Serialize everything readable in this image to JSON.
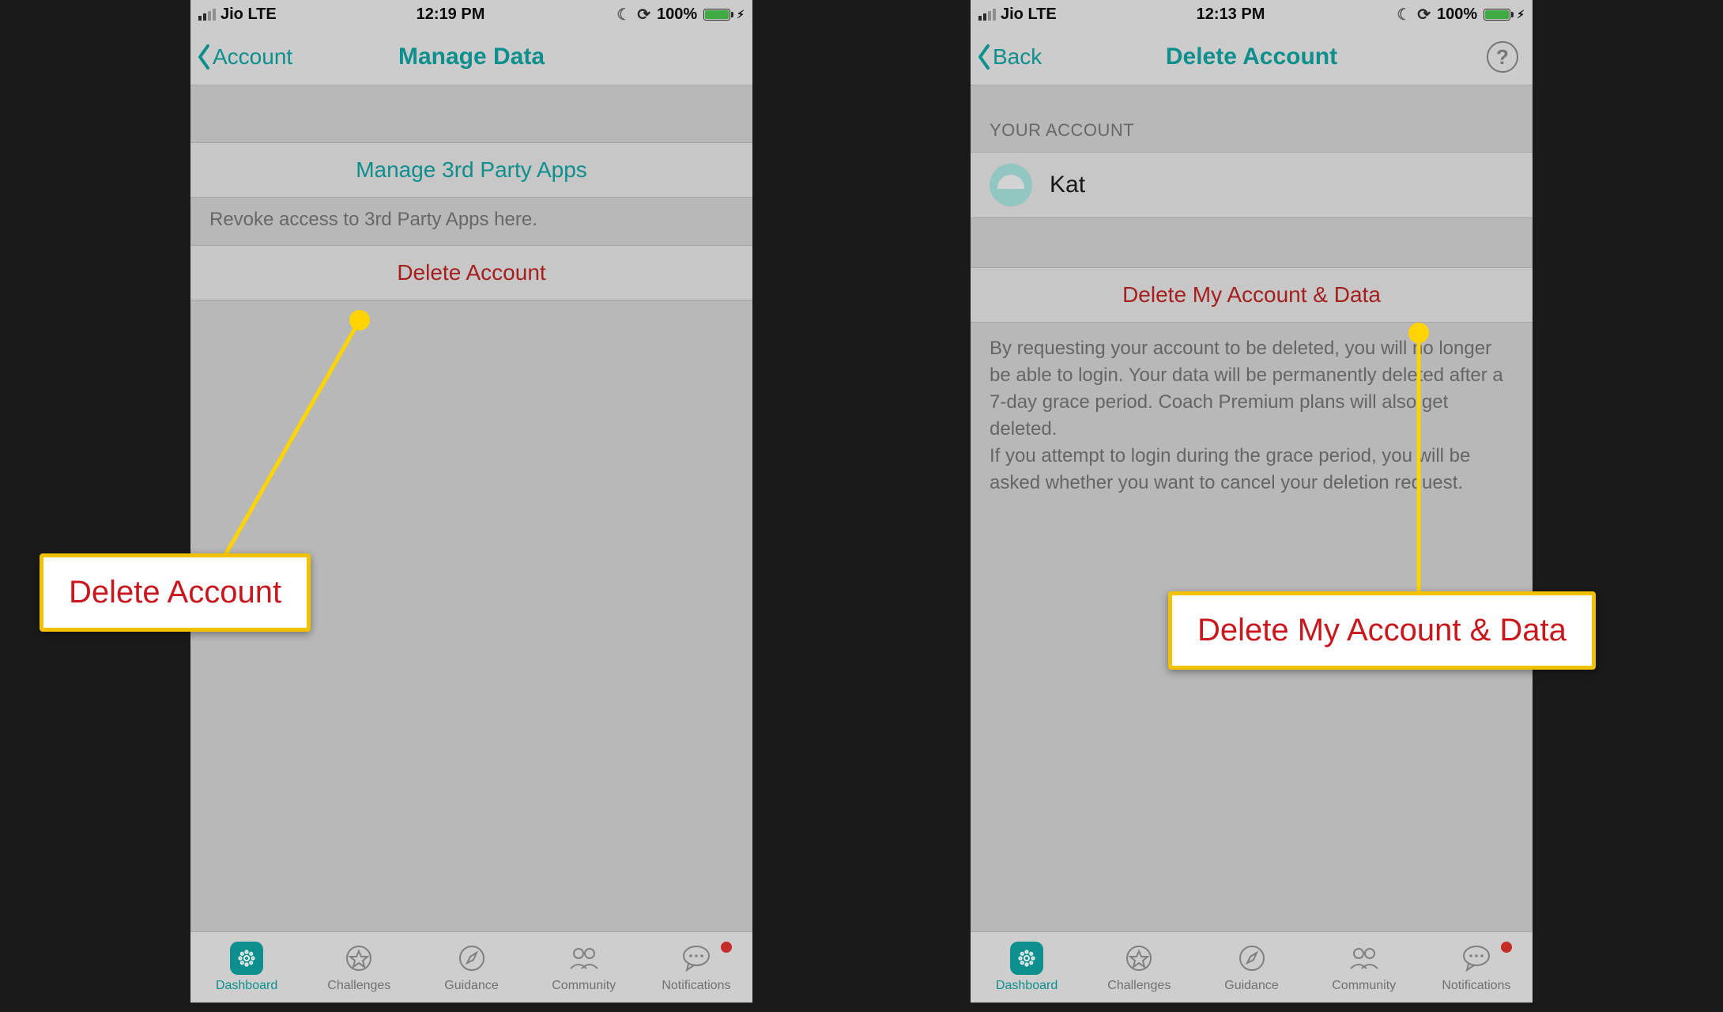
{
  "colors": {
    "teal": "#0f9a99",
    "red": "#b32222",
    "accentYellow": "#f2c200"
  },
  "left": {
    "status": {
      "carrier": "Jio  LTE",
      "time": "12:19 PM",
      "battery": "100%"
    },
    "nav": {
      "back": "Account",
      "title": "Manage Data"
    },
    "manageRow": "Manage 3rd Party Apps",
    "revokeHelper": "Revoke access to 3rd Party Apps here.",
    "deleteRow": "Delete Account",
    "tabs": {
      "dashboard": "Dashboard",
      "challenges": "Challenges",
      "guidance": "Guidance",
      "community": "Community",
      "notifications": "Notifications"
    },
    "callout": "Delete Account"
  },
  "right": {
    "status": {
      "carrier": "Jio  LTE",
      "time": "12:13 PM",
      "battery": "100%"
    },
    "nav": {
      "back": "Back",
      "title": "Delete Account",
      "help": "?"
    },
    "sectionHeader": "YOUR ACCOUNT",
    "accountName": "Kat",
    "deleteRow": "Delete My Account & Data",
    "bodyText": "By requesting your account to be deleted, you will no longer be able to login. Your data will be permanently deleted after a 7-day grace period. Coach Premium plans will also get deleted.\nIf you attempt to login during the grace period, you will be asked whether you want to cancel your deletion request.",
    "tabs": {
      "dashboard": "Dashboard",
      "challenges": "Challenges",
      "guidance": "Guidance",
      "community": "Community",
      "notifications": "Notifications"
    },
    "callout": "Delete My Account & Data"
  }
}
